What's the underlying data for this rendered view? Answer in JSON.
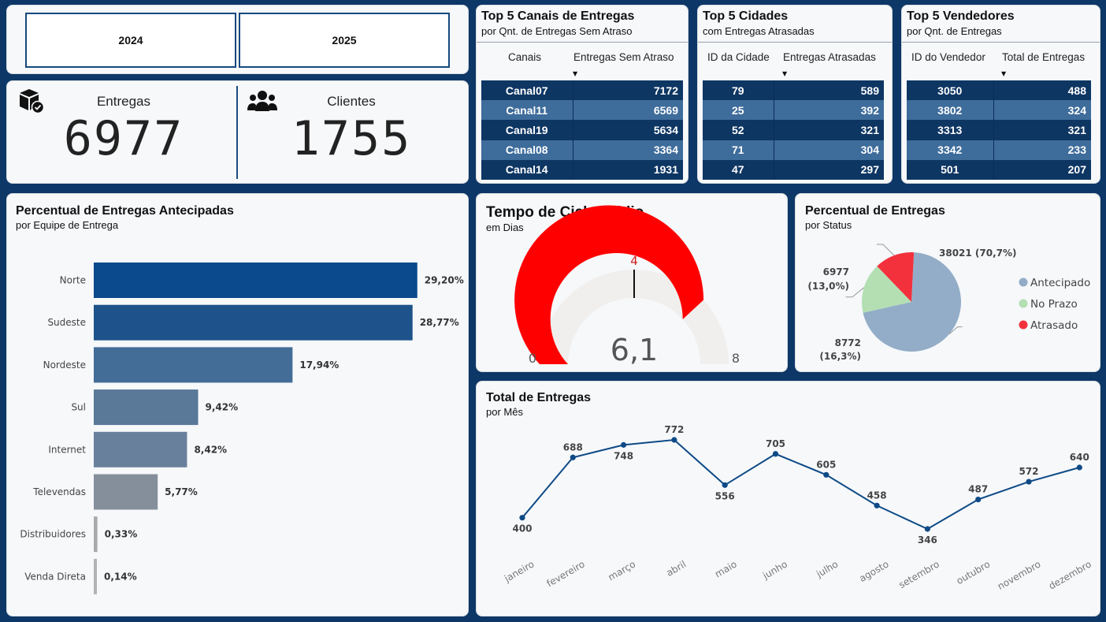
{
  "slicer": {
    "years": [
      "2024",
      "2025"
    ]
  },
  "kpis": {
    "entregas": {
      "label": "Entregas",
      "value": "6977",
      "icon": "package-check-icon"
    },
    "clientes": {
      "label": "Clientes",
      "value": "1755",
      "icon": "users-group-icon"
    }
  },
  "tables": {
    "canais": {
      "title": "Top 5 Canais de Entregas",
      "subtitle": "por Qnt. de Entregas Sem Atraso",
      "col1": "Canais",
      "col2": "Entregas Sem Atraso",
      "rows": [
        [
          "Canal07",
          "7172"
        ],
        [
          "Canal11",
          "6569"
        ],
        [
          "Canal19",
          "5634"
        ],
        [
          "Canal08",
          "3364"
        ],
        [
          "Canal14",
          "1931"
        ]
      ]
    },
    "cidades": {
      "title": "Top 5 Cidades",
      "subtitle": "com Entregas Atrasadas",
      "col1": "ID da Cidade",
      "col2": "Entregas Atrasadas",
      "rows": [
        [
          "79",
          "589"
        ],
        [
          "25",
          "392"
        ],
        [
          "52",
          "321"
        ],
        [
          "71",
          "304"
        ],
        [
          "47",
          "297"
        ]
      ]
    },
    "vendedores": {
      "title": "Top 5 Vendedores",
      "subtitle": "por Qnt. de Entregas",
      "col1": "ID do Vendedor",
      "col2": "Total de Entregas",
      "rows": [
        [
          "3050",
          "488"
        ],
        [
          "3802",
          "324"
        ],
        [
          "3313",
          "321"
        ],
        [
          "3342",
          "233"
        ],
        [
          "501",
          "207"
        ]
      ]
    }
  },
  "bar_panel": {
    "title": "Percentual de Entregas Antecipadas",
    "subtitle": "por Equipe de Entrega"
  },
  "gauge_panel": {
    "title": "Tempo de Ciclo Médio",
    "subtitle": "em Dias"
  },
  "pie_panel": {
    "title": "Percentual de Entregas",
    "subtitle": "por Status"
  },
  "line_panel": {
    "title": "Total de Entregas",
    "subtitle": "por Mês"
  },
  "chart_data": [
    {
      "type": "bar",
      "orientation": "horizontal",
      "categories": [
        "Norte",
        "Sudeste",
        "Nordeste",
        "Sul",
        "Internet",
        "Televendas",
        "Distribuidores",
        "Venda Direta"
      ],
      "values": [
        29.2,
        28.77,
        17.94,
        9.42,
        8.42,
        5.77,
        0.33,
        0.14
      ],
      "labels": [
        "29,20%",
        "28,77%",
        "17,94%",
        "9,42%",
        "8,42%",
        "5,77%",
        "0,33%",
        "0,14%"
      ],
      "colors": [
        "#0b4a8c",
        "#1d528a",
        "#436c97",
        "#5a7898",
        "#69809d",
        "#858f9c",
        "#a7a9ab",
        "#b2b3b5"
      ],
      "title": "Percentual de Entregas Antecipadas"
    },
    {
      "type": "gauge",
      "value": 6.1,
      "value_label": "6,1",
      "min": 0,
      "max": 8,
      "target": 4,
      "min_label": "0",
      "max_label": "8",
      "target_label": "4",
      "fill_color": "#ff0000",
      "track_color": "#f0efed",
      "target_color": "#d21b1b",
      "title": "Tempo de Ciclo Médio"
    },
    {
      "type": "pie",
      "slices": [
        {
          "name": "Antecipado",
          "value": 38021,
          "label": "38021 (70,7%)",
          "color": "#93adc8"
        },
        {
          "name": "No Prazo",
          "value": 8772,
          "label1": "8772",
          "label2": "(16,3%)",
          "color": "#b3dfb3"
        },
        {
          "name": "Atrasado",
          "value": 6977,
          "label1": "6977",
          "label2": "(13,0%)",
          "color": "#f3313c"
        }
      ],
      "title": "Percentual de Entregas"
    },
    {
      "type": "line",
      "x": [
        "janeiro",
        "fevereiro",
        "março",
        "abril",
        "maio",
        "junho",
        "julho",
        "agosto",
        "setembro",
        "outubro",
        "novembro",
        "dezembro"
      ],
      "values": [
        400,
        688,
        748,
        772,
        556,
        705,
        605,
        458,
        346,
        487,
        572,
        640
      ],
      "color": "#0e4a86",
      "title": "Total de Entregas"
    }
  ]
}
